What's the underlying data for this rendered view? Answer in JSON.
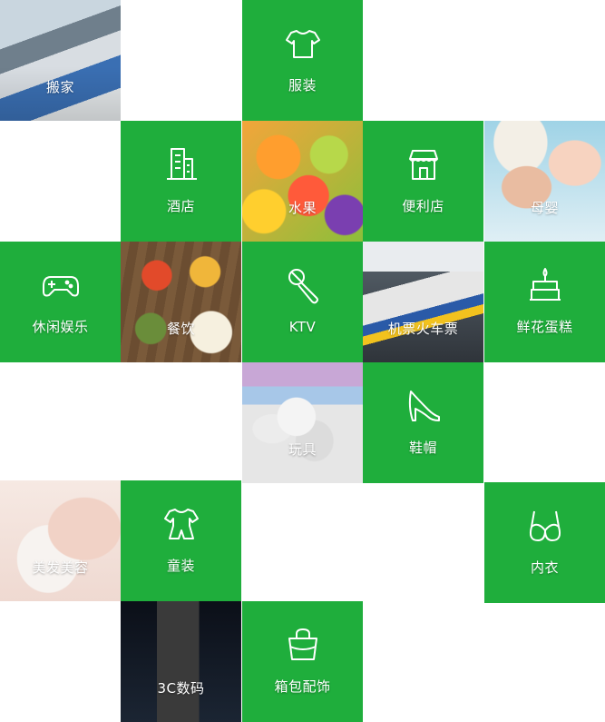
{
  "tiles": {
    "moving": {
      "label": "搬家",
      "icon": "photo"
    },
    "clothing": {
      "label": "服装",
      "icon": "tshirt-icon"
    },
    "hotel": {
      "label": "酒店",
      "icon": "building-icon"
    },
    "fruit": {
      "label": "水果",
      "icon": "photo"
    },
    "convenience": {
      "label": "便利店",
      "icon": "store-icon"
    },
    "maternity": {
      "label": "母婴",
      "icon": "photo"
    },
    "entertainment": {
      "label": "休闲娱乐",
      "icon": "gamepad-icon"
    },
    "dining": {
      "label": "餐饮",
      "icon": "photo"
    },
    "ktv": {
      "label": "KTV",
      "icon": "microphone-icon"
    },
    "tickets": {
      "label": "机票火车票",
      "icon": "photo"
    },
    "cake": {
      "label": "鲜花蛋糕",
      "icon": "cake-icon"
    },
    "toys": {
      "label": "玩具",
      "icon": "photo"
    },
    "shoes": {
      "label": "鞋帽",
      "icon": "high-heel-icon"
    },
    "beauty": {
      "label": "美发美容",
      "icon": "photo"
    },
    "kids": {
      "label": "童装",
      "icon": "kids-clothes-icon"
    },
    "underwear": {
      "label": "内衣",
      "icon": "bra-icon"
    },
    "digital": {
      "label": "3C数码",
      "icon": "photo"
    },
    "bags": {
      "label": "箱包配饰",
      "icon": "handbag-icon"
    }
  },
  "colors": {
    "tile_green": "#1fae3c",
    "text": "#ffffff"
  }
}
